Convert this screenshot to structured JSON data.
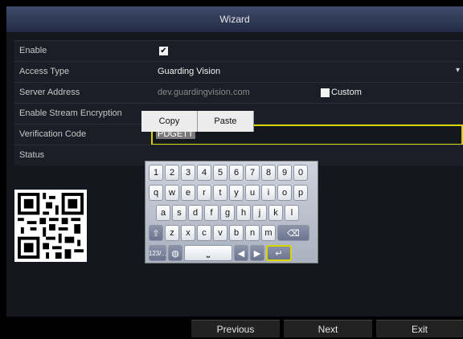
{
  "window": {
    "title": "Wizard"
  },
  "fields": {
    "enable": {
      "label": "Enable",
      "checked": "✔"
    },
    "access_type": {
      "label": "Access Type",
      "value": "Guarding Vision"
    },
    "server_address": {
      "label": "Server Address",
      "value": "dev.guardingvision.com",
      "custom_label": "Custom"
    },
    "stream_encryption": {
      "label": "Enable Stream Encryption"
    },
    "verification_code": {
      "label": "Verification Code",
      "value": "PDGETT"
    },
    "status": {
      "label": "Status"
    }
  },
  "clipboard": {
    "copy": "Copy",
    "paste": "Paste"
  },
  "keyboard": {
    "row1": [
      "1",
      "2",
      "3",
      "4",
      "5",
      "6",
      "7",
      "8",
      "9",
      "0"
    ],
    "row2": [
      "q",
      "w",
      "e",
      "r",
      "t",
      "y",
      "u",
      "i",
      "o",
      "p"
    ],
    "row3": [
      "a",
      "s",
      "d",
      "f",
      "g",
      "h",
      "j",
      "k",
      "l"
    ],
    "row4": [
      "z",
      "x",
      "c",
      "v",
      "b",
      "n",
      "m"
    ],
    "symbols_label": "123/...",
    "shift_icon": "up-arrow-icon",
    "backspace_icon": "backspace-icon",
    "globe_icon": "globe-icon",
    "left_icon": "left-arrow-icon",
    "right_icon": "right-arrow-icon",
    "enter_icon": "enter-icon"
  },
  "qr": {
    "icon": "qr-code-icon"
  },
  "footer": {
    "previous": "Previous",
    "next": "Next",
    "exit": "Exit"
  },
  "colors": {
    "accent": "#d8d400",
    "title_bar": "#2b3552"
  }
}
